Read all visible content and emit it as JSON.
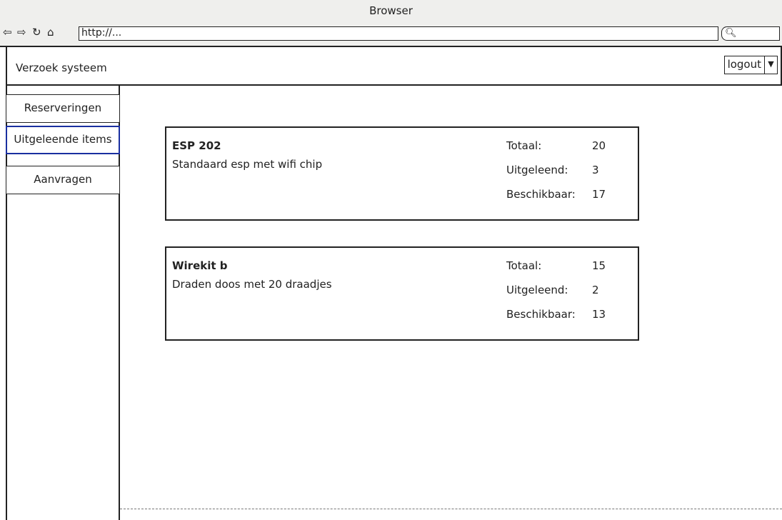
{
  "browser": {
    "title": "Browser",
    "url": "http://...",
    "icons": [
      "back-arrow-icon",
      "forward-arrow-icon",
      "reload-icon",
      "home-icon",
      "search-icon"
    ]
  },
  "header": {
    "title": "Verzoek systeem",
    "logout_label": "logout"
  },
  "sidebar": {
    "items": [
      {
        "label": "Reserveringen",
        "active": false
      },
      {
        "label": "Uitgeleende items",
        "active": true
      },
      {
        "label": "Aanvragen",
        "active": false
      }
    ]
  },
  "items": [
    {
      "name": "ESP 202",
      "description": "Standaard esp met wifi chip",
      "labels": {
        "total": "Totaal:",
        "borrowed": "Uitgeleend:",
        "available": "Beschikbaar:"
      },
      "total": "20",
      "borrowed": "3",
      "available": "17"
    },
    {
      "name": "Wirekit b",
      "description": "Draden doos met 20 draadjes",
      "labels": {
        "total": "Totaal:",
        "borrowed": "Uitgeleend:",
        "available": "Beschikbaar:"
      },
      "total": "15",
      "borrowed": "2",
      "available": "13"
    }
  ],
  "colors": {
    "active_border": "#1a2fa0",
    "chrome_bg": "#efefed"
  }
}
